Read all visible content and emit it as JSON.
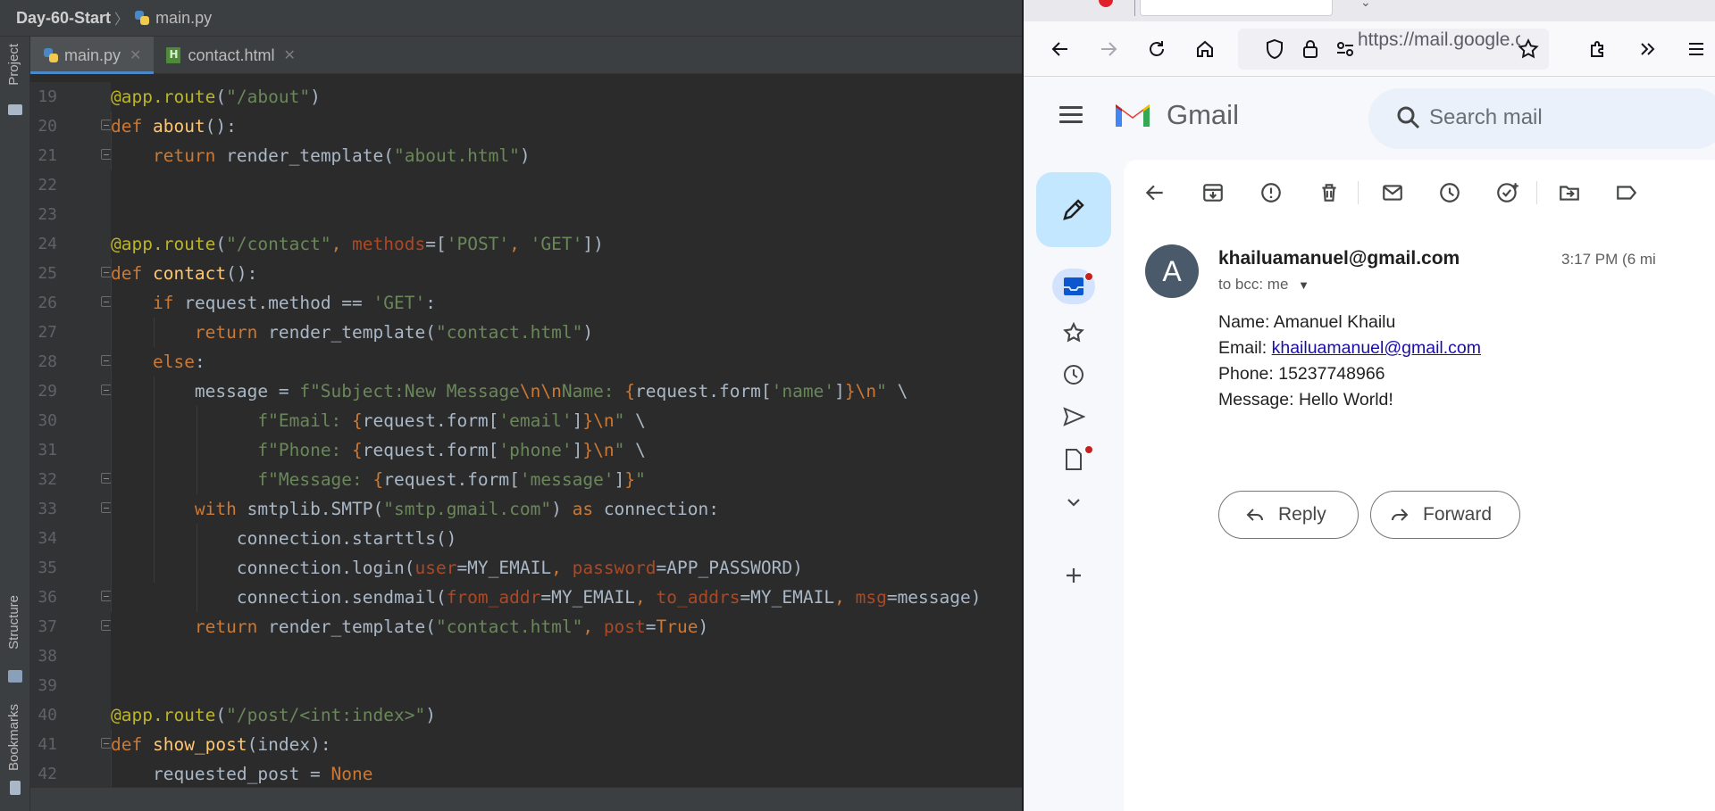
{
  "ide": {
    "breadcrumb": {
      "project": "Day-60-Start",
      "file": "main.py"
    },
    "tabs": [
      {
        "label": "main.py",
        "active": true
      },
      {
        "label": "contact.html",
        "active": false
      }
    ],
    "side_tabs": {
      "project": "Project",
      "structure": "Structure",
      "bookmarks": "Bookmarks"
    },
    "line_numbers": [
      "19",
      "20",
      "21",
      "22",
      "23",
      "24",
      "25",
      "26",
      "27",
      "28",
      "29",
      "30",
      "31",
      "32",
      "33",
      "34",
      "35",
      "36",
      "37",
      "38",
      "39",
      "40",
      "41",
      "42"
    ]
  },
  "browser": {
    "url": "https://mail.google.com"
  },
  "gmail": {
    "logo_text": "Gmail",
    "search_placeholder": "Search mail",
    "email": {
      "avatar_letter": "A",
      "from": "khailuamanuel@gmail.com",
      "time": "3:17 PM (6 mi",
      "to": "to bcc: me",
      "body": {
        "name": "Name: Amanuel Khailu",
        "email_label": "Email: ",
        "email_link": "khailuamanuel@gmail.com",
        "phone": "Phone: 15237748966",
        "message": "Message: Hello World!"
      }
    },
    "reply_label": "Reply",
    "forward_label": "Forward"
  },
  "colors": {
    "ide_bg": "#2b2b2b",
    "keyword": "#cc7832",
    "function": "#ffc66d",
    "decorator": "#bbb529",
    "string": "#6a8759",
    "compose_bg": "#c2e7ff"
  }
}
